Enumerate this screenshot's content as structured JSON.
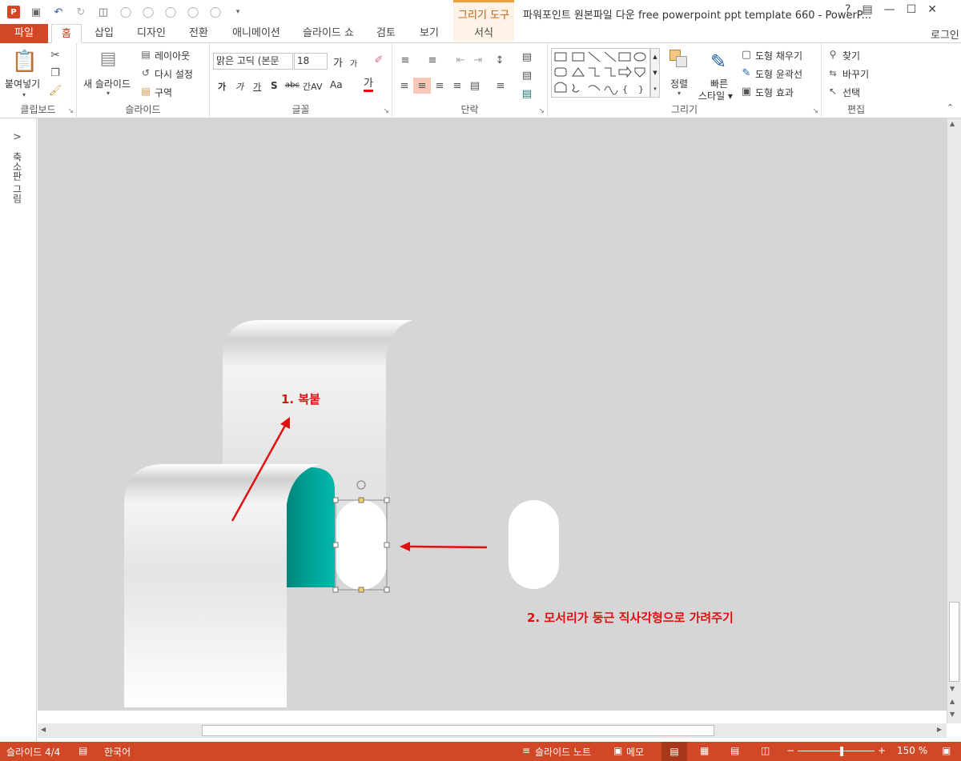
{
  "window": {
    "title": "파워포인트 원본파일 다운 free powerpoint ppt template 660 - PowerP...",
    "help": "?",
    "login": "로그인"
  },
  "contextual_tab": {
    "group_label": "그리기 도구",
    "tab_label": "서식"
  },
  "tabs": [
    "파일",
    "홈",
    "삽입",
    "디자인",
    "전환",
    "애니메이션",
    "슬라이드 쇼",
    "검토",
    "보기"
  ],
  "ribbon": {
    "clipboard": {
      "paste": "붙여넣기",
      "label": "클립보드"
    },
    "slides": {
      "new_slide": "새 슬라이드",
      "layout": "레이아웃",
      "reset": "다시 설정",
      "section": "구역",
      "label": "슬라이드"
    },
    "font": {
      "font_name": "맑은 고딕 (본문",
      "font_size": "18",
      "grow": "가",
      "shrink": "가",
      "bold": "가",
      "italic": "가",
      "underline": "가",
      "shadow": "S",
      "strike": "abc",
      "spacing": "간AV",
      "case": "Aa",
      "color": "가",
      "label": "글꼴"
    },
    "paragraph": {
      "label": "단락"
    },
    "drawing": {
      "arrange": "정렬",
      "quick_styles": "빠른 스타일",
      "fill": "도형 채우기",
      "outline": "도형 윤곽선",
      "effects": "도형 효과",
      "label": "그리기"
    },
    "editing": {
      "find": "찾기",
      "replace": "바꾸기",
      "select": "선택",
      "label": "편집"
    }
  },
  "left_pane": {
    "label": "축소판 그림",
    "expand": ">"
  },
  "annotations": {
    "step1": "1. 복붙",
    "step2": "2. 모서리가 둥근 직사각형으로 가려주기"
  },
  "status": {
    "slide": "슬라이드 4/4",
    "language": "한국어",
    "notes": "슬라이드 노트",
    "comments": "메모",
    "zoom": "150 %"
  },
  "colors": {
    "accent": "#D24726",
    "teal": "#00A99D",
    "annotation": "#E01010",
    "canvas": "#D6D6D6"
  }
}
